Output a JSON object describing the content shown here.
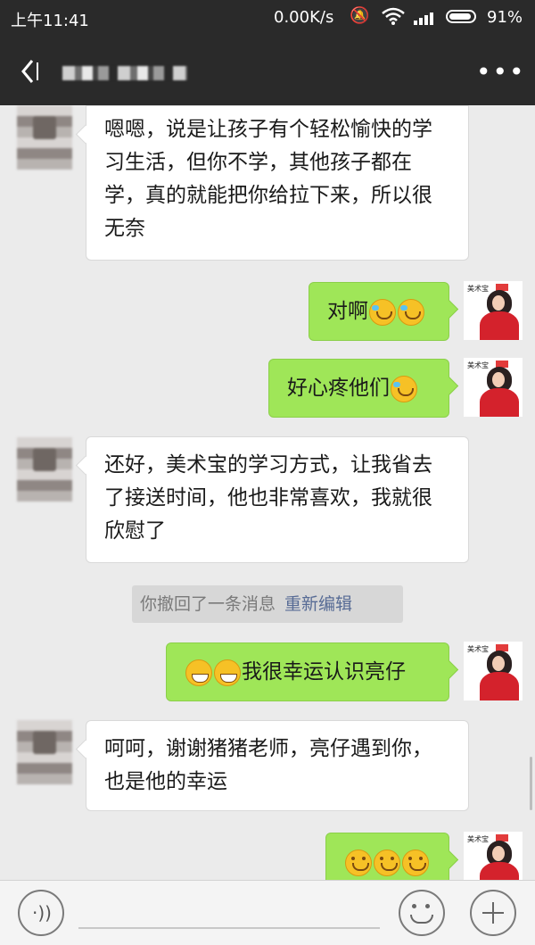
{
  "status_bar": {
    "time": "上午11:41",
    "network_speed": "0.00K/s",
    "battery": "91%"
  },
  "header": {
    "title": "",
    "back_icon": "back-arrow-icon",
    "more_icon": "more-dots-icon"
  },
  "messages": [
    {
      "side": "left",
      "text": "嗯嗯，说是让孩子有个轻松愉快的学习生活，但你不学，其他孩子都在学，真的就能把你给拉下来，所以很无奈"
    },
    {
      "side": "right",
      "text": "对啊",
      "emojis": [
        "cry",
        "cry"
      ]
    },
    {
      "side": "right",
      "text": "好心疼他们",
      "emojis": [
        "cry"
      ]
    },
    {
      "side": "left",
      "text": "还好，美术宝的学习方式，让我省去了接送时间，他也非常喜欢，我就很欣慰了"
    },
    {
      "side": "right",
      "text": "我很幸运认识亮仔",
      "emojis": [
        "grin",
        "grin"
      ]
    },
    {
      "side": "left",
      "text": "呵呵，谢谢猪猪老师，亮仔遇到你，也是他的幸运"
    },
    {
      "side": "right",
      "text": "",
      "emojis": [
        "smile",
        "smile",
        "smile"
      ]
    }
  ],
  "recall_notice": {
    "text": "你撤回了一条消息",
    "action": "重新编辑"
  },
  "avatar_right": {
    "brand_text": "美术宝"
  },
  "bottom_bar": {
    "voice_icon": "voice-icon",
    "emoji_icon": "emoji-icon",
    "plus_icon": "plus-icon"
  }
}
